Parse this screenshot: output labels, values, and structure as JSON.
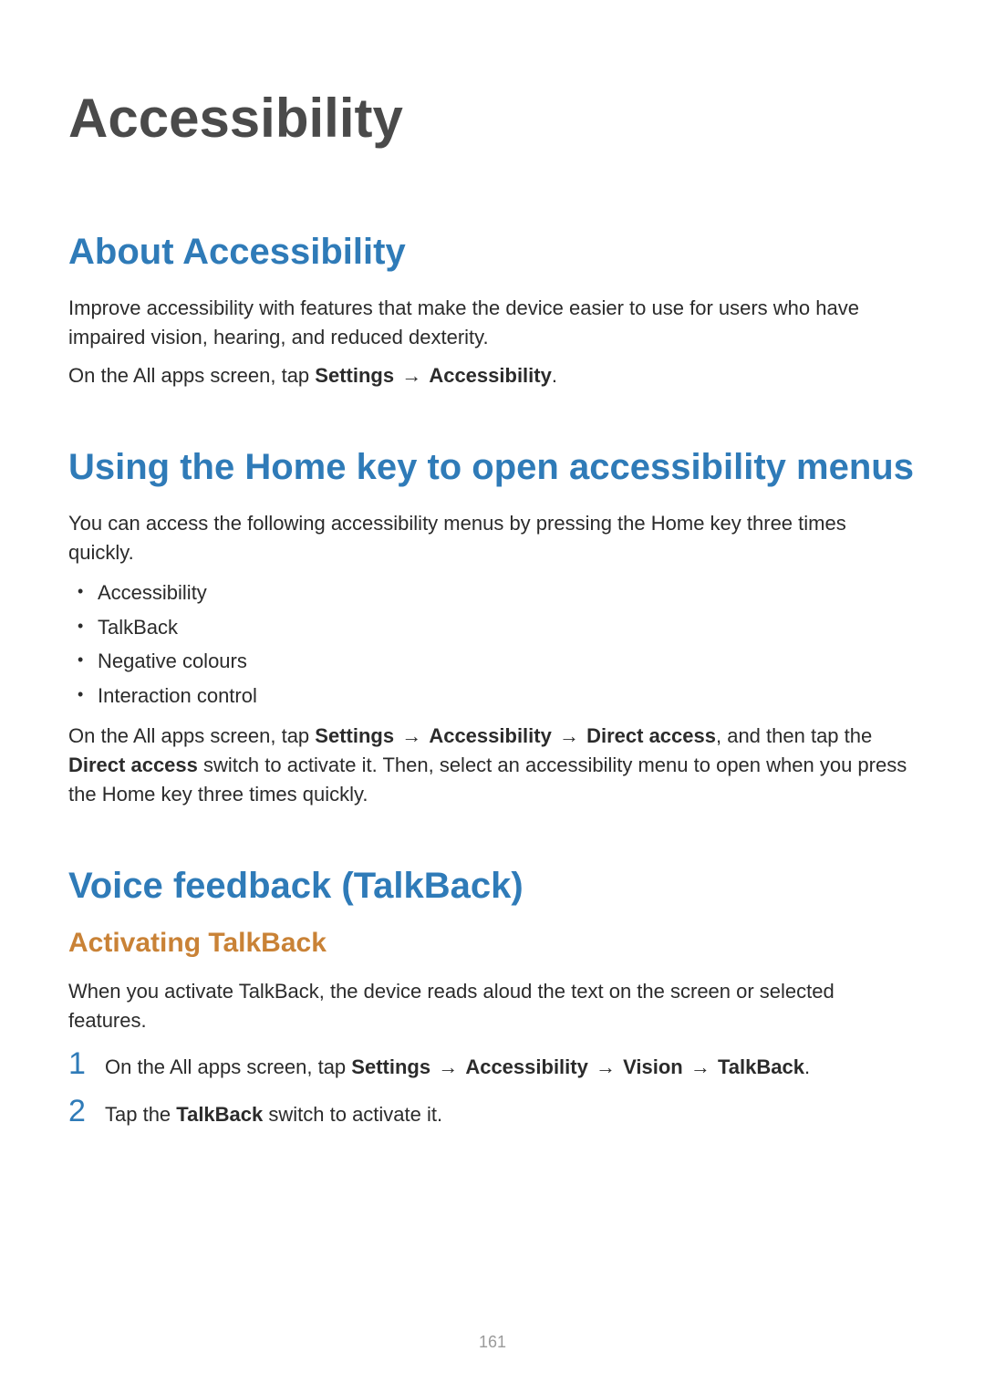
{
  "colors": {
    "heading_blue": "#2f7bb8",
    "heading_orange": "#c98236",
    "body": "#2b2b2b"
  },
  "page_title": "Accessibility",
  "page_number": "161",
  "arrow_glyph": "→",
  "section_about": {
    "heading": "About Accessibility",
    "p1": "Improve accessibility with features that make the device easier to use for users who have impaired vision, hearing, and reduced dexterity.",
    "p2_prefix": "On the All apps screen, tap ",
    "p2_b1": "Settings",
    "p2_b2": "Accessibility",
    "p2_suffix": "."
  },
  "section_homekey": {
    "heading": "Using the Home key to open accessibility menus",
    "p1": "You can access the following accessibility menus by pressing the Home key three times quickly.",
    "bullets": [
      "Accessibility",
      "TalkBack",
      "Negative colours",
      "Interaction control"
    ],
    "p2_prefix": "On the All apps screen, tap ",
    "p2_b1": "Settings",
    "p2_b2": "Accessibility",
    "p2_b3": "Direct access",
    "p2_mid": ", and then tap the ",
    "p2_b4": "Direct access",
    "p2_suffix": " switch to activate it. Then, select an accessibility menu to open when you press the Home key three times quickly."
  },
  "section_talkback": {
    "heading": "Voice feedback (TalkBack)",
    "sub_heading": "Activating TalkBack",
    "p1": "When you activate TalkBack, the device reads aloud the text on the screen or selected features.",
    "steps": {
      "s1_num": "1",
      "s1_prefix": "On the All apps screen, tap ",
      "s1_b1": "Settings",
      "s1_b2": "Accessibility",
      "s1_b3": "Vision",
      "s1_b4": "TalkBack",
      "s1_suffix": ".",
      "s2_num": "2",
      "s2_prefix": "Tap the ",
      "s2_b1": "TalkBack",
      "s2_suffix": " switch to activate it."
    }
  }
}
